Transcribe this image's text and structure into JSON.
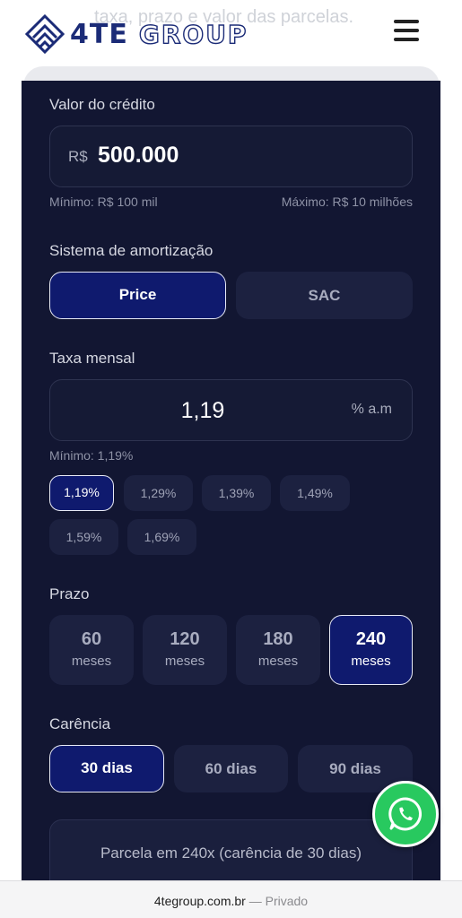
{
  "header": {
    "background_text": "taxa, prazo e valor das parcelas.",
    "logo_name": "4TE",
    "logo_suffix": "GROUP",
    "menu_icon": "hamburger-menu-icon"
  },
  "credit": {
    "label": "Valor do crédito",
    "currency": "R$",
    "value": "500.000",
    "min_hint": "Mínimo: R$ 100 mil",
    "max_hint": "Máximo: R$ 10 milhões"
  },
  "amortization": {
    "label": "Sistema de amortização",
    "options": [
      {
        "label": "Price",
        "selected": true
      },
      {
        "label": "SAC",
        "selected": false
      }
    ]
  },
  "rate": {
    "label": "Taxa mensal",
    "value": "1,19",
    "unit": "% a.m",
    "min_hint": "Mínimo: 1,19%",
    "chips": [
      {
        "label": "1,19%",
        "selected": true
      },
      {
        "label": "1,29%",
        "selected": false
      },
      {
        "label": "1,39%",
        "selected": false
      },
      {
        "label": "1,49%",
        "selected": false
      },
      {
        "label": "1,59%",
        "selected": false
      },
      {
        "label": "1,69%",
        "selected": false
      }
    ]
  },
  "term": {
    "label": "Prazo",
    "options": [
      {
        "number": "60",
        "unit": "meses",
        "selected": false
      },
      {
        "number": "120",
        "unit": "meses",
        "selected": false
      },
      {
        "number": "180",
        "unit": "meses",
        "selected": false
      },
      {
        "number": "240",
        "unit": "meses",
        "selected": true
      }
    ]
  },
  "grace": {
    "label": "Carência",
    "options": [
      {
        "label": "30 dias",
        "selected": true
      },
      {
        "label": "60 dias",
        "selected": false
      },
      {
        "label": "90 dias",
        "selected": false
      }
    ]
  },
  "result": {
    "text": "Parcela em 240x (carência de 30 dias)"
  },
  "whatsapp": {
    "icon": "whatsapp-icon"
  },
  "browser": {
    "host": "4tegroup.com.br",
    "separator": "—",
    "mode": "Privado"
  },
  "colors": {
    "card_background": "#121632",
    "selected_option": "#0f1a6e",
    "unselected_option": "#1c2140",
    "brand_blue": "#1b2b77",
    "whatsapp_green": "#28c95f"
  }
}
